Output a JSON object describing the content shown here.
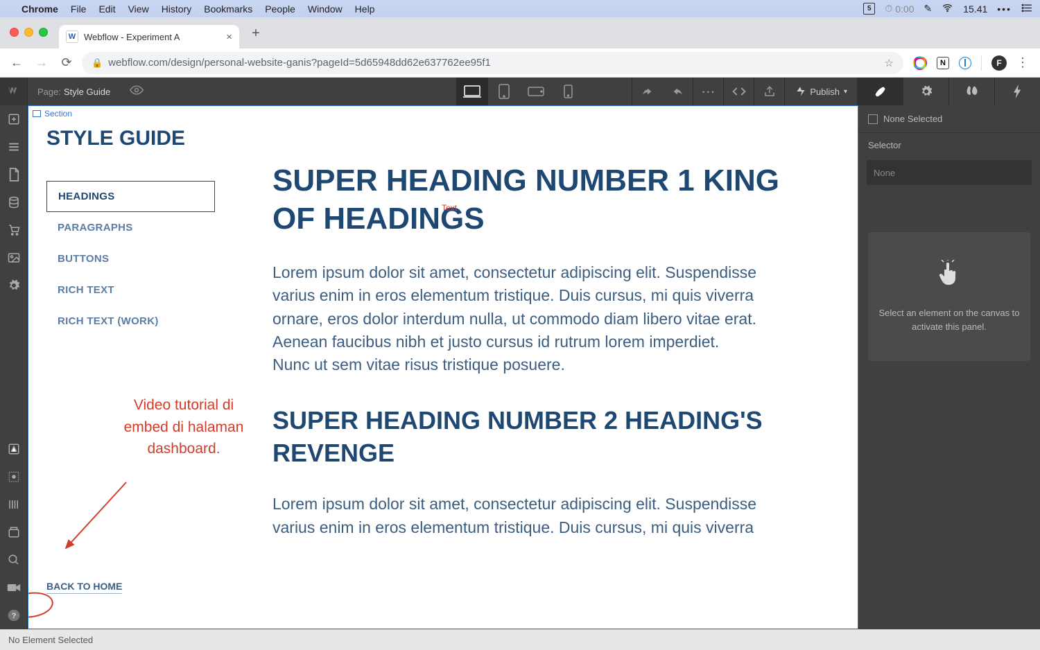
{
  "mac_menu": {
    "app": "Chrome",
    "items": [
      "File",
      "Edit",
      "View",
      "History",
      "Bookmarks",
      "People",
      "Window",
      "Help"
    ],
    "right": {
      "calendar_badge": "5",
      "timer": "0:00",
      "clock": "15.41"
    }
  },
  "browser": {
    "tab_title": "Webflow - Experiment A",
    "url": "webflow.com/design/personal-website-ganis?pageId=5d65948dd62e637762ee95f1",
    "avatar_initial": "F",
    "notion_ext": "N"
  },
  "webflow_top": {
    "page_label": "Page:",
    "page_value": "Style Guide",
    "publish": "Publish"
  },
  "right_panel": {
    "none_selected": "None Selected",
    "selector_label": "Selector",
    "selector_value": "None",
    "empty_msg": "Select an element on the canvas to activate this panel."
  },
  "canvas": {
    "section_label": "Section",
    "text_marker": "Text",
    "sidebar_title": "STYLE GUIDE",
    "nav": [
      "HEADINGS",
      "PARAGRAPHS",
      "BUTTONS",
      "RICH TEXT",
      "RICH TEXT (WORK)"
    ],
    "back_link": "BACK TO HOME",
    "h1": "SUPER HEADING NUMBER 1 KING OF HEADINGS",
    "p1": "Lorem ipsum dolor sit amet, consectetur adipiscing elit. Suspendisse varius enim in eros elementum tristique. Duis cursus, mi quis viverra ornare, eros dolor interdum nulla, ut commodo diam libero vitae erat. Aenean faucibus nibh et justo cursus id rutrum lorem imperdiet. Nunc ut sem vitae risus tristique posuere.",
    "h2": "SUPER HEADING NUMBER 2 HEADING'S REVENGE",
    "p2": "Lorem ipsum dolor sit amet, consectetur adipiscing elit. Suspendisse varius enim in eros elementum tristique. Duis cursus, mi quis viverra"
  },
  "annotation": "Video tutorial di embed di halaman dashboard.",
  "status_bar": "No Element Selected"
}
